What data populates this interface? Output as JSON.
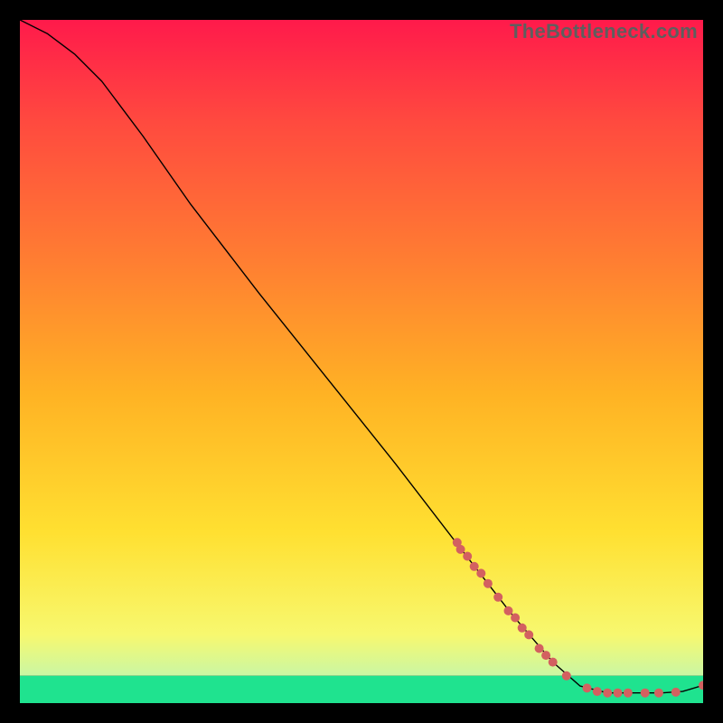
{
  "chart_data": {
    "type": "line",
    "title": "",
    "xlabel": "",
    "ylabel": "",
    "xlim": [
      0,
      100
    ],
    "ylim": [
      0,
      100
    ],
    "watermark": "TheBottleneck.com",
    "background": {
      "solid_band": {
        "from_y": 0,
        "to_y": 4,
        "color": "#1fe38f"
      },
      "gradient_stops": [
        {
          "y": 4,
          "color": "#caf7a4"
        },
        {
          "y": 10,
          "color": "#f7f86f"
        },
        {
          "y": 25,
          "color": "#ffe031"
        },
        {
          "y": 45,
          "color": "#ffb324"
        },
        {
          "y": 65,
          "color": "#ff7d32"
        },
        {
          "y": 85,
          "color": "#ff4a3f"
        },
        {
          "y": 100,
          "color": "#ff1a4b"
        }
      ]
    },
    "curve": {
      "color": "#000000",
      "width": 1.4,
      "points": [
        {
          "x": 0,
          "y": 100
        },
        {
          "x": 4,
          "y": 98
        },
        {
          "x": 8,
          "y": 95
        },
        {
          "x": 12,
          "y": 91
        },
        {
          "x": 18,
          "y": 83
        },
        {
          "x": 25,
          "y": 73
        },
        {
          "x": 35,
          "y": 60
        },
        {
          "x": 45,
          "y": 47.5
        },
        {
          "x": 55,
          "y": 35
        },
        {
          "x": 65,
          "y": 22
        },
        {
          "x": 72,
          "y": 13
        },
        {
          "x": 78,
          "y": 6
        },
        {
          "x": 82,
          "y": 2.5
        },
        {
          "x": 86,
          "y": 1.5
        },
        {
          "x": 90,
          "y": 1.5
        },
        {
          "x": 94,
          "y": 1.5
        },
        {
          "x": 97,
          "y": 1.7
        },
        {
          "x": 100,
          "y": 2.6
        }
      ]
    },
    "markers": {
      "color": "#d36060",
      "radius": 5,
      "points": [
        {
          "x": 64,
          "y": 23.5
        },
        {
          "x": 64.5,
          "y": 22.5
        },
        {
          "x": 65.5,
          "y": 21.5
        },
        {
          "x": 66.5,
          "y": 20
        },
        {
          "x": 67.5,
          "y": 19
        },
        {
          "x": 68.5,
          "y": 17.5
        },
        {
          "x": 70,
          "y": 15.5
        },
        {
          "x": 71.5,
          "y": 13.5
        },
        {
          "x": 72.5,
          "y": 12.5
        },
        {
          "x": 73.5,
          "y": 11
        },
        {
          "x": 74.5,
          "y": 10
        },
        {
          "x": 76,
          "y": 8
        },
        {
          "x": 77,
          "y": 7
        },
        {
          "x": 78,
          "y": 6
        },
        {
          "x": 80,
          "y": 4
        },
        {
          "x": 83,
          "y": 2.2
        },
        {
          "x": 84.5,
          "y": 1.7
        },
        {
          "x": 86,
          "y": 1.5
        },
        {
          "x": 87.5,
          "y": 1.5
        },
        {
          "x": 89,
          "y": 1.5
        },
        {
          "x": 91.5,
          "y": 1.5
        },
        {
          "x": 93.5,
          "y": 1.5
        },
        {
          "x": 96,
          "y": 1.6
        },
        {
          "x": 100,
          "y": 2.6
        }
      ]
    }
  }
}
